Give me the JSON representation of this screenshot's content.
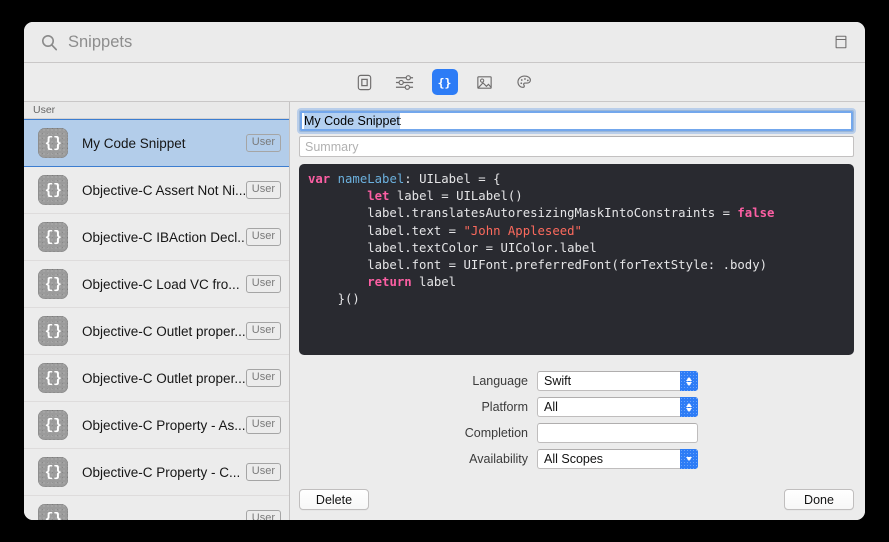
{
  "window": {
    "title_bar": {
      "search_placeholder": "Snippets",
      "search_value": "",
      "search_icon": "search-icon",
      "panel_toggle_icon": "panel-toggle-icon"
    },
    "toolbar": {
      "items": [
        {
          "icon": "rectangle-icon",
          "label": "Views",
          "selected": false
        },
        {
          "icon": "sliders-icon",
          "label": "Modifiers",
          "selected": false
        },
        {
          "icon": "code-braces-icon",
          "label": "Snippets",
          "selected": true
        },
        {
          "icon": "photo-icon",
          "label": "Media",
          "selected": false
        },
        {
          "icon": "palette-icon",
          "label": "Colors",
          "selected": false
        }
      ]
    }
  },
  "sidebar": {
    "header": "User",
    "items": [
      {
        "title": "My Code Snippet",
        "badge": "User",
        "icon": "code-braces-icon",
        "selected": true
      },
      {
        "title": "Objective-C Assert Not Ni...",
        "badge": "User",
        "icon": "code-braces-icon",
        "selected": false
      },
      {
        "title": "Objective-C IBAction Decl...",
        "badge": "User",
        "icon": "code-braces-icon",
        "selected": false
      },
      {
        "title": "Objective-C Load VC fro...",
        "badge": "User",
        "icon": "code-braces-icon",
        "selected": false
      },
      {
        "title": "Objective-C Outlet proper...",
        "badge": "User",
        "icon": "code-braces-icon",
        "selected": false
      },
      {
        "title": "Objective-C Outlet proper...",
        "badge": "User",
        "icon": "code-braces-icon",
        "selected": false
      },
      {
        "title": "Objective-C Property - As...",
        "badge": "User",
        "icon": "code-braces-icon",
        "selected": false
      },
      {
        "title": "Objective-C Property - C...",
        "badge": "User",
        "icon": "code-braces-icon",
        "selected": false
      },
      {
        "title": "",
        "badge": "User",
        "icon": "code-braces-icon",
        "selected": false
      }
    ]
  },
  "detail": {
    "title_field": {
      "value": "My Code Snippet",
      "selected": true,
      "focused": true
    },
    "summary_field": {
      "value": "",
      "placeholder": "Summary"
    },
    "code": {
      "language_display": "Swift",
      "plain_text": "var nameLabel: UILabel = {\n        let label = UILabel()\n        label.translatesAutoresizingMaskIntoConstraints = false\n        label.text = \"John Appleseed\"\n        label.textColor = UIColor.label\n        label.font = UIFont.preferredFont(forTextStyle: .body)\n        return label\n    }()",
      "lines": [
        [
          {
            "t": "var",
            "c": "kw"
          },
          {
            "t": " ",
            "c": "plain"
          },
          {
            "t": "nameLabel",
            "c": "var"
          },
          {
            "t": ": UILabel = {",
            "c": "plain"
          }
        ],
        [
          {
            "t": "        ",
            "c": "plain"
          },
          {
            "t": "let",
            "c": "kw"
          },
          {
            "t": " label = UILabel()",
            "c": "plain"
          }
        ],
        [
          {
            "t": "        label.translatesAutoresizingMaskIntoConstraints = ",
            "c": "plain"
          },
          {
            "t": "false",
            "c": "kw"
          }
        ],
        [
          {
            "t": "        label.text = ",
            "c": "plain"
          },
          {
            "t": "\"John Appleseed\"",
            "c": "str"
          }
        ],
        [
          {
            "t": "        label.textColor = UIColor.label",
            "c": "plain"
          }
        ],
        [
          {
            "t": "        label.font = UIFont.preferredFont(forTextStyle: .body)",
            "c": "plain"
          }
        ],
        [
          {
            "t": "        ",
            "c": "plain"
          },
          {
            "t": "return",
            "c": "kw"
          },
          {
            "t": " label",
            "c": "plain"
          }
        ],
        [
          {
            "t": "    }()",
            "c": "plain"
          }
        ]
      ]
    },
    "form": [
      {
        "label": "Language",
        "value": "Swift",
        "control": "stepper-select",
        "name": "language"
      },
      {
        "label": "Platform",
        "value": "All",
        "control": "stepper-select",
        "name": "platform"
      },
      {
        "label": "Completion",
        "value": "",
        "control": "text-field",
        "name": "completion",
        "placeholder": ""
      },
      {
        "label": "Availability",
        "value": "All Scopes",
        "control": "popup-select",
        "name": "availability"
      }
    ],
    "buttons": {
      "delete": "Delete",
      "done": "Done"
    }
  },
  "colors": {
    "accent_blue": "#2d7cf6",
    "selection_blue": "#b3cdea",
    "editor_bg": "#292a30",
    "keyword_pink": "#fc5fa3",
    "string_red": "#fc6a5d",
    "variable_blue": "#6bb0dd",
    "window_bg": "#ececec"
  }
}
